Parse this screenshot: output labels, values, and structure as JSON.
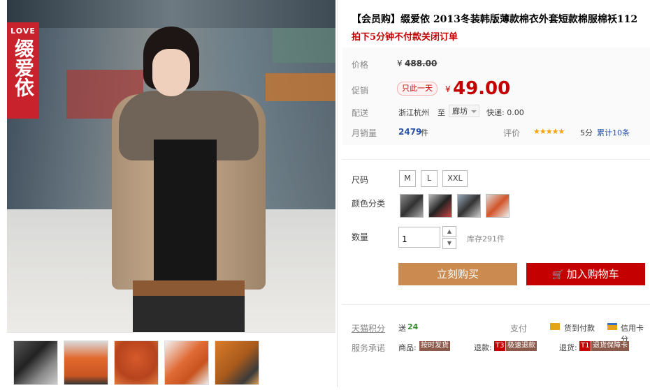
{
  "gallery": {
    "logo_line1": "LOVE",
    "logo_line2": "缀爱依",
    "thumbnail_count": 5
  },
  "product": {
    "title": "【会员购】缀爱依 2013冬装韩版薄款棉衣外套短款棉服棉袄112",
    "subtitle": "拍下5分钟不付款关闭订单"
  },
  "price": {
    "label": "价格",
    "currency": "¥",
    "original": "488.00",
    "promo_label": "促销",
    "promo_badge": "只此一天",
    "promo_price": "49.00"
  },
  "delivery": {
    "label": "配送",
    "from": "浙江杭州",
    "to_word": "至",
    "destination": "廊坊",
    "shipping": "快递: 0.00"
  },
  "sales": {
    "label": "月销量",
    "count": "2479",
    "unit": "件",
    "rating_label": "评价",
    "stars": "★★★★★",
    "score": "5分",
    "reviews": "累计10条"
  },
  "options": {
    "size_label": "尺码",
    "sizes": [
      "M",
      "L",
      "XXL"
    ],
    "color_label": "颜色分类",
    "quantity_label": "数量",
    "quantity_value": "1",
    "stock": "库存291件"
  },
  "actions": {
    "buy_now": "立刻购买",
    "add_to_cart": "加入购物车"
  },
  "services": {
    "points_label": "天猫积分",
    "points_text": "送",
    "points_value": "24",
    "pay_label": "支付",
    "cod": "货到付款",
    "credit": "信用卡分",
    "promise_label": "服务承诺",
    "goods_prefix": "商品:",
    "goods_tag": "按时发货",
    "refund_prefix": "退款:",
    "refund_code": "T3",
    "refund_tag": "极速退款",
    "return_prefix": "退货:",
    "return_code": "T1",
    "return_tag": "退货保障卡"
  },
  "colors": {
    "price_red": "#c40000",
    "buy_orange": "#cb8a4f",
    "cart_red": "#c40000",
    "service_tag": "#8b5a4a"
  }
}
